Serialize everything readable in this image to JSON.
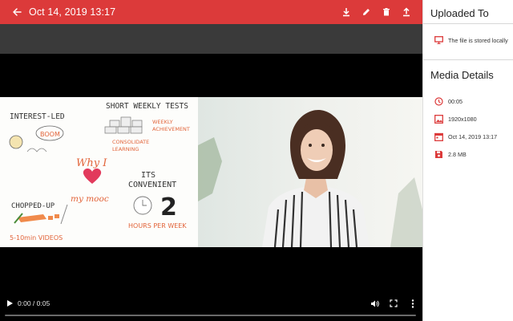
{
  "header": {
    "title": "Oct 14, 2019 13:17",
    "actions": [
      "download-icon",
      "edit-icon",
      "delete-icon",
      "upload-icon"
    ]
  },
  "colors": {
    "accent": "#dc3a3a",
    "panel_bg": "#ffffff",
    "player_bg": "#000000"
  },
  "video": {
    "sketch": {
      "interest": "INTEREST-LED",
      "boom": "BOOM",
      "short_tests": "SHORT WEEKLY TESTS",
      "weekly": "WEEKLY",
      "achievement": "ACHIEVEMENT",
      "consolidate": "CONSOLIDATE",
      "learning": "LEARNING",
      "why_i": "Why I",
      "my_mooc": "my mooc",
      "its": "ITS",
      "convenient": "CONVENIENT",
      "chopped": "CHOPPED-UP",
      "videos": "5-10min VIDEOS",
      "two": "2",
      "hours": "HOURS PER WEEK"
    }
  },
  "controls": {
    "time": "0:00 / 0:05",
    "progress": 0
  },
  "sidebar": {
    "uploaded_to": {
      "title": "Uploaded To",
      "location": "The file is stored locally"
    },
    "media_details": {
      "title": "Media Details",
      "duration": "00:05",
      "resolution": "1920x1080",
      "date": "Oct 14, 2019 13:17",
      "size": "2.8 MB"
    }
  }
}
